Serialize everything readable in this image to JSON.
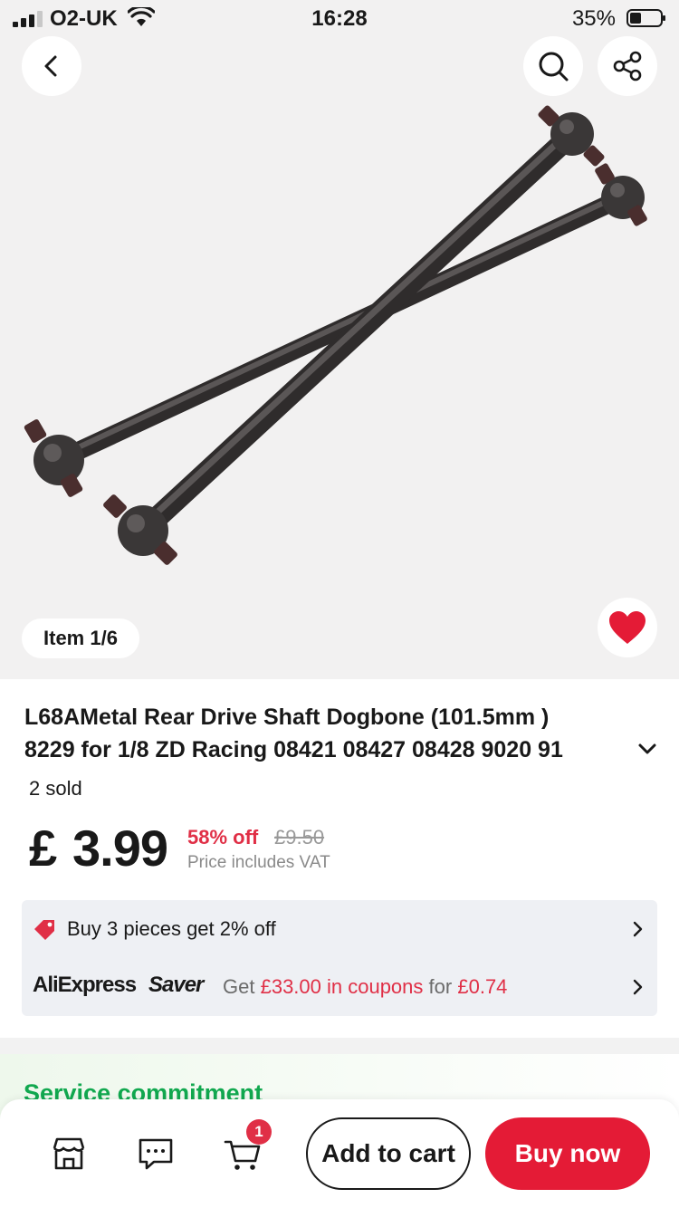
{
  "status_bar": {
    "carrier": "O2-UK",
    "time": "16:28",
    "battery_percent": "35%"
  },
  "gallery": {
    "counter": "Item 1/6",
    "icons": [
      "back-icon",
      "search-icon",
      "share-icon",
      "heart-icon"
    ],
    "favorite_color": "#e41b36"
  },
  "product": {
    "title_line1": "L68AMetal Rear Drive Shaft Dogbone (101.5mm )",
    "title_line2": "8229 for 1/8 ZD Racing 08421 08427 08428 9020 91",
    "sold": "2 sold",
    "currency": "£",
    "price": "3.99",
    "discount": "58% off",
    "original_price": "£9.50",
    "vat_note": "Price includes VAT"
  },
  "promotions": {
    "bundle_text": "Buy 3 pieces get 2% off",
    "brand_logo": "AliExpress",
    "saver_logo": "Saver",
    "coupon_prefix": "Get",
    "coupon_amount": "£33.00 in coupons",
    "coupon_for": "for",
    "coupon_price": "£0.74"
  },
  "service": {
    "title": "Service commitment"
  },
  "bottom_bar": {
    "cart_count": "1",
    "add_to_cart_label": "Add to cart",
    "buy_now_label": "Buy now"
  },
  "colors": {
    "accent": "#e41b36",
    "discount_red": "#e02f46",
    "service_green": "#11a84f"
  }
}
